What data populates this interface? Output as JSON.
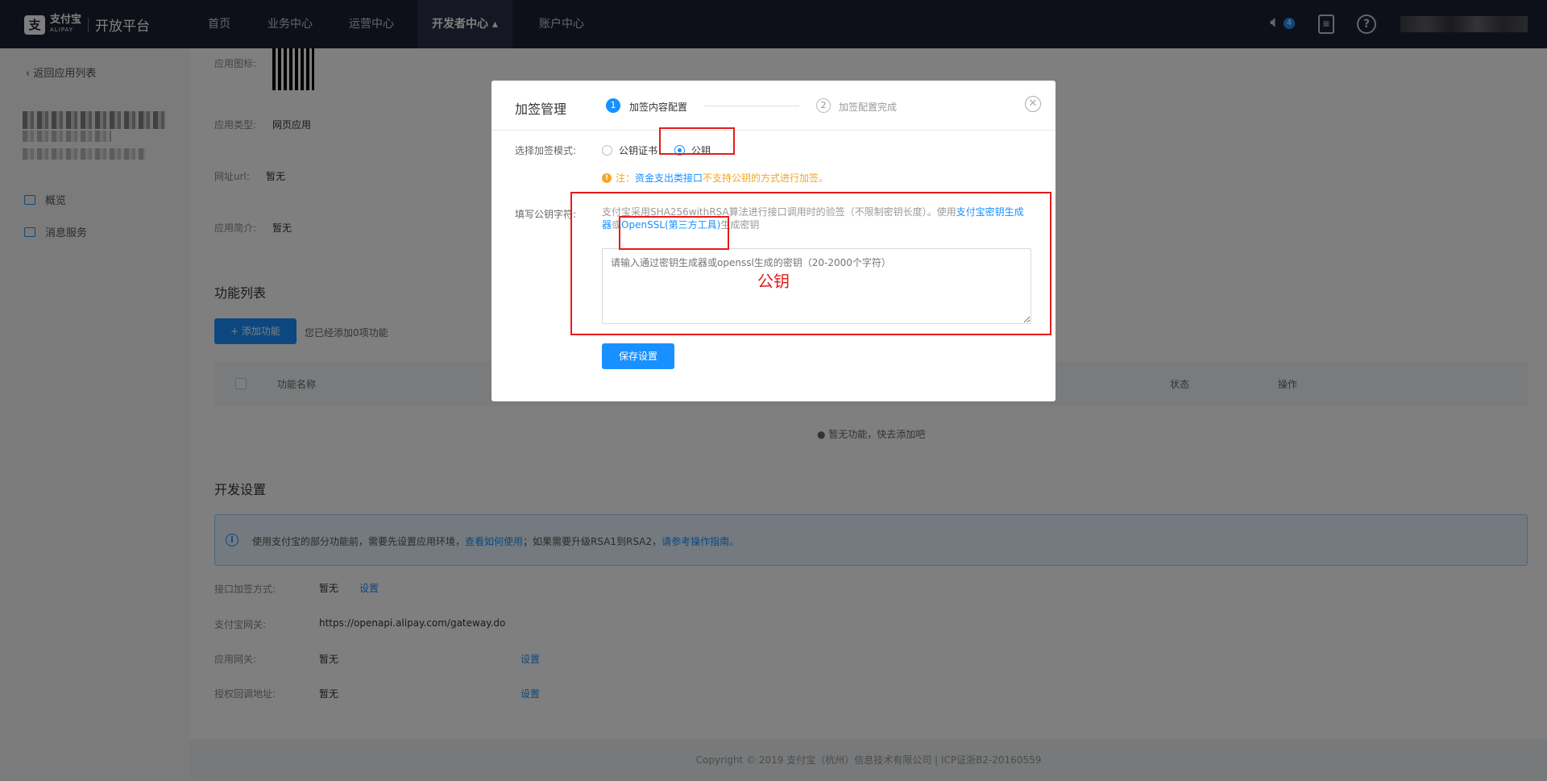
{
  "nav": {
    "brand_mark": "支",
    "brand_name": "支付宝",
    "brand_sub": "ALIPAY",
    "platform": "开放平台",
    "items": [
      "首页",
      "业务中心",
      "运营中心",
      "开发者中心 ▴",
      "账户中心"
    ],
    "active_index": 3,
    "notification_count": "4"
  },
  "sidebar": {
    "back_label": "返回应用列表",
    "items": [
      "概览",
      "消息服务"
    ]
  },
  "app_info": {
    "icon_label": "应用图标:",
    "type_label": "应用类型:",
    "type_value": "网页应用",
    "url_label": "网址url:",
    "url_value": "暂无",
    "intro_label": "应用简介:",
    "intro_value": "暂无"
  },
  "features": {
    "title": "功能列表",
    "add_button": "+ 添加功能",
    "count_text": "您已经添加0项功能",
    "columns": [
      "功能名称",
      "状态",
      "操作"
    ],
    "empty_text": "暂无功能，快去添加吧"
  },
  "dev_settings": {
    "title": "开发设置",
    "alert_prefix": "使用支付宝的部分功能前，需要先设置应用环境，",
    "alert_link1": "查看如何使用",
    "alert_middle": "；如果需要升级RSA1到RSA2，",
    "alert_link2": "请参考操作指南。",
    "rows": [
      {
        "label": "接口加签方式:",
        "value": "暂无",
        "action": "设置"
      },
      {
        "label": "支付宝网关:",
        "value": "https://openapi.alipay.com/gateway.do",
        "action": ""
      },
      {
        "label": "应用网关:",
        "value": "暂无",
        "action": "设置"
      },
      {
        "label": "授权回调地址:",
        "value": "暂无",
        "action": "设置"
      }
    ]
  },
  "footer": "Copyright © 2019 支付宝（杭州）信息技术有限公司 | ICP证浙B2-20160559",
  "modal": {
    "title": "加签管理",
    "steps": [
      {
        "num": "1",
        "label": "加签内容配置"
      },
      {
        "num": "2",
        "label": "加签配置完成"
      }
    ],
    "close_glyph": "✕",
    "mode_label": "选择加签模式:",
    "mode_options": [
      "公钥证书",
      "公钥"
    ],
    "mode_selected": 1,
    "note_prefix": "注：",
    "note_link": "资金支出类接口",
    "note_suffix": "不支持公钥的方式进行加签。",
    "key_label": "填写公钥字符:",
    "desc_prefix": "支付宝采用SHA256withRSA算法进行接口调用时的验签（不限制密钥长度）。使用",
    "desc_link1": "支付宝密钥生成器",
    "desc_or": "或",
    "desc_link2": "OpenSSL(第三方工具)",
    "desc_suffix": "生成密钥",
    "textarea_placeholder": "请输入通过密钥生成器或openssl生成的密钥（20-2000个字符）",
    "save_button": "保存设置"
  },
  "annotation": {
    "text": "公钥",
    "color": "#e61b1b"
  },
  "colors": {
    "accent": "#1890ff",
    "nav_bg": "#1d2033",
    "warning": "#f5a623"
  }
}
